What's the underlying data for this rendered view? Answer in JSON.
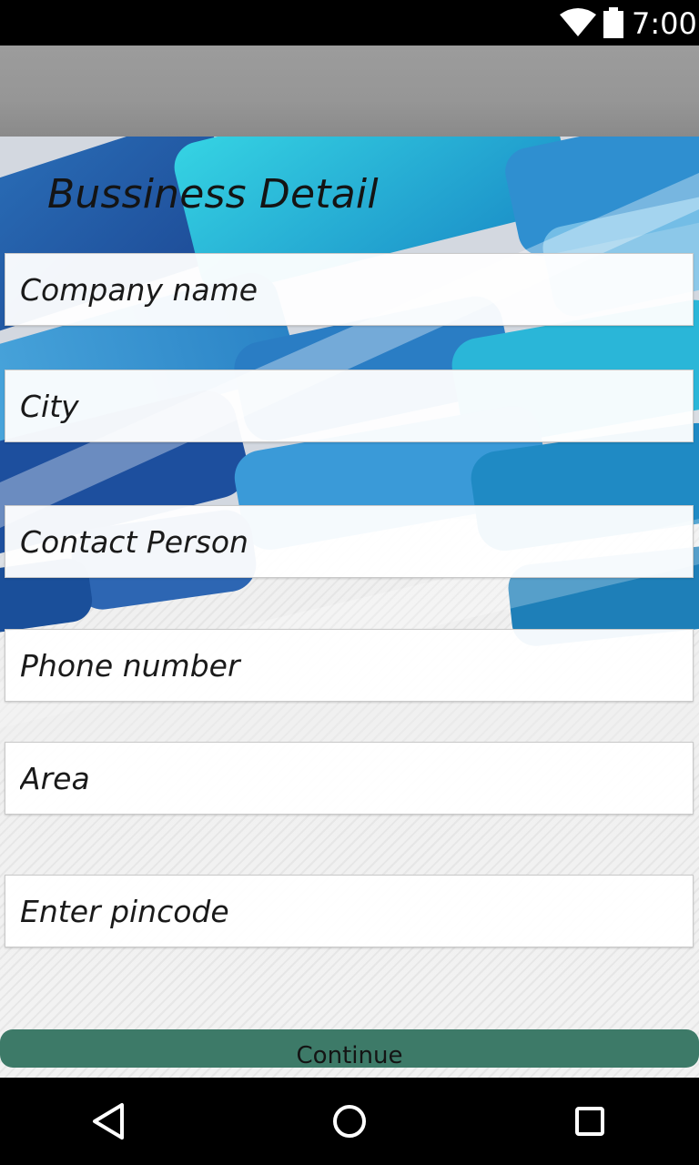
{
  "status_bar": {
    "time": "7:00",
    "icons": [
      "wifi-icon",
      "battery-icon"
    ]
  },
  "page": {
    "title": "Bussiness Detail"
  },
  "form": {
    "fields": [
      {
        "placeholder": "Company name",
        "value": ""
      },
      {
        "placeholder": "City",
        "value": ""
      },
      {
        "placeholder": "Contact Person",
        "value": ""
      },
      {
        "placeholder": "Phone number",
        "value": ""
      },
      {
        "placeholder": "Area",
        "value": ""
      },
      {
        "placeholder": "Enter pincode",
        "value": ""
      }
    ],
    "continue_label": "Continue"
  },
  "nav_bar": {
    "icons": [
      "back-icon",
      "home-icon",
      "recents-icon"
    ]
  },
  "colors": {
    "app_bar": "#999999",
    "button": "#3d7a68",
    "accent_blue": "#2bb3d6"
  }
}
